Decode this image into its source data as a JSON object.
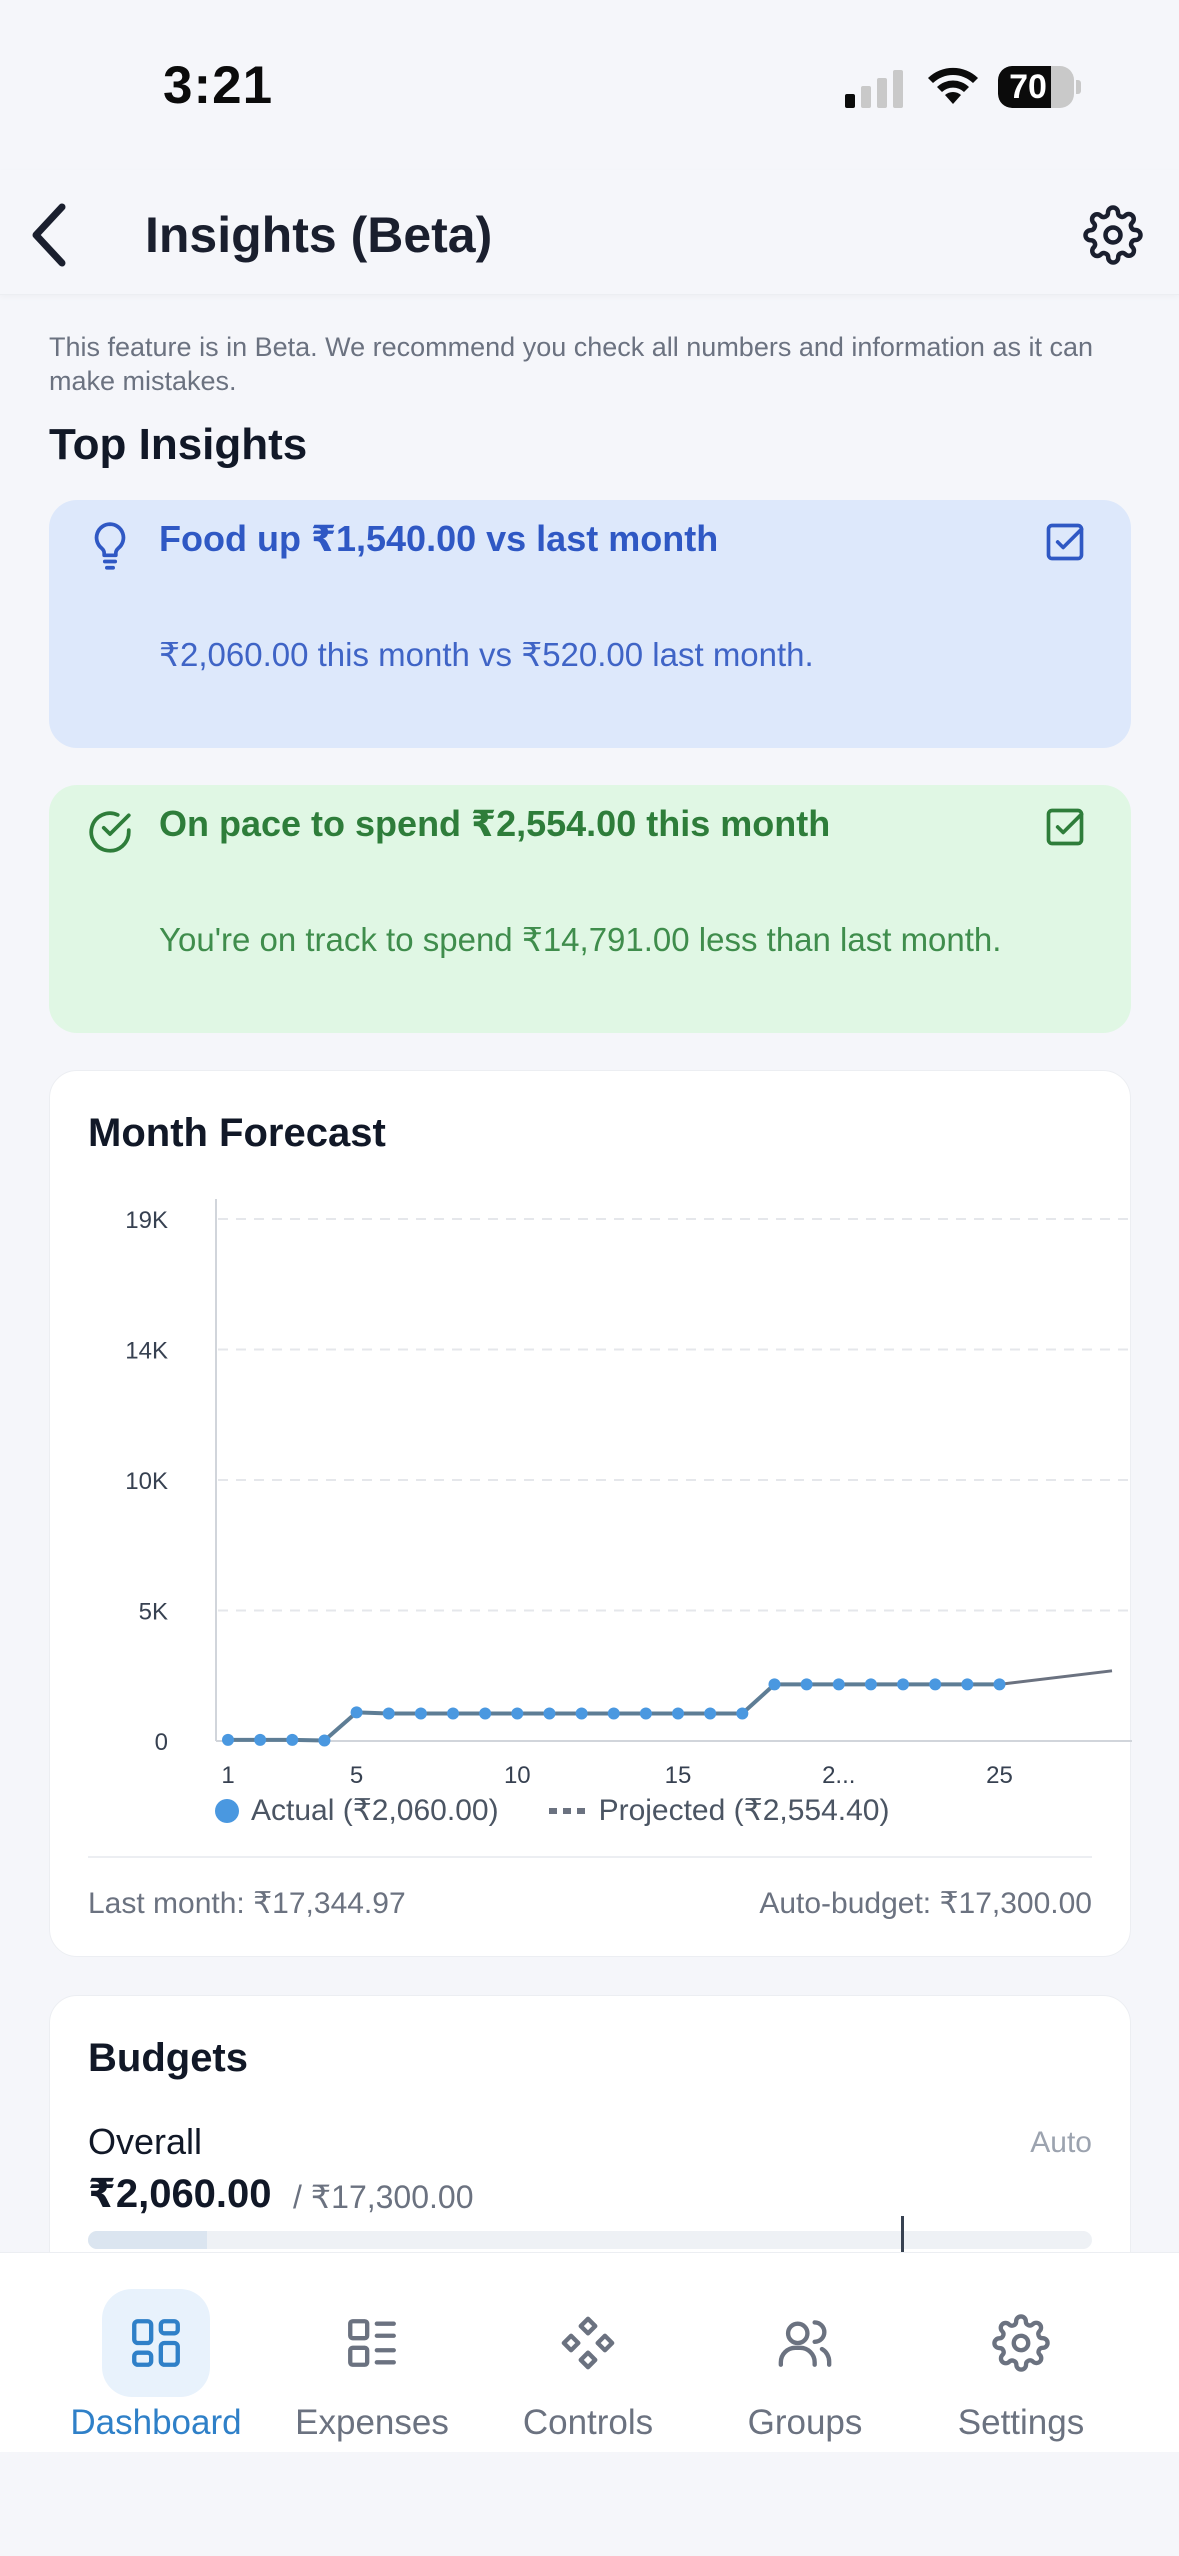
{
  "status_bar": {
    "time": "3:21",
    "battery_level": "70",
    "battery_fraction": 0.7
  },
  "header": {
    "title": "Insights (Beta)",
    "back_icon": "chevron-left-icon",
    "settings_icon": "gear-icon"
  },
  "beta_note": "This feature is in Beta. We recommend you check all numbers and information as it can make mistakes.",
  "top_insights": {
    "heading": "Top Insights",
    "cards": [
      {
        "icon": "lightbulb-icon",
        "title": "Food up ₹1,540.00 vs last month",
        "body": "₹2,060.00 this month vs ₹520.00 last month.",
        "color": "#2f58c4"
      },
      {
        "icon": "check-circle-icon",
        "title": "On pace to spend ₹2,554.00 this month",
        "body": "You're on track to spend ₹14,791.00 less than last month.",
        "color": "#2e7d3a"
      }
    ]
  },
  "forecast": {
    "title": "Month Forecast",
    "legend_actual": "Actual (₹2,060.00)",
    "legend_projected": "Projected (₹2,554.40)",
    "last_month": "Last month: ₹17,344.97",
    "auto_budget": "Auto-budget: ₹17,300.00"
  },
  "chart_data": {
    "type": "line",
    "title": "Month Forecast",
    "xlabel": "",
    "ylabel": "",
    "xlim": [
      1,
      28.5
    ],
    "ylim": [
      0,
      19000
    ],
    "x_ticks": [
      {
        "value": 1,
        "label": "1"
      },
      {
        "value": 5,
        "label": "5"
      },
      {
        "value": 10,
        "label": "10"
      },
      {
        "value": 15,
        "label": "15"
      },
      {
        "value": 20,
        "label": "2..."
      },
      {
        "value": 25,
        "label": "25"
      }
    ],
    "y_ticks": [
      {
        "value": 0,
        "label": "0"
      },
      {
        "value": 4750,
        "label": "5K"
      },
      {
        "value": 9500,
        "label": "10K"
      },
      {
        "value": 14250,
        "label": "14K"
      },
      {
        "value": 19000,
        "label": "19K"
      }
    ],
    "grid": true,
    "legend_position": "bottom",
    "series": [
      {
        "name": "Actual (₹2,060.00)",
        "color": "#4a98e0",
        "line_color": "#5e7d95",
        "x": [
          1,
          2,
          3,
          4,
          5,
          6,
          7,
          8,
          9,
          10,
          11,
          12,
          13,
          14,
          15,
          16,
          17,
          18,
          19,
          20,
          21,
          22,
          23,
          24,
          25
        ],
        "y": [
          40,
          40,
          40,
          20,
          1040,
          1000,
          1000,
          1000,
          1000,
          1000,
          1000,
          1000,
          1000,
          1000,
          1000,
          1000,
          1000,
          2060,
          2060,
          2060,
          2060,
          2060,
          2060,
          2060,
          2060
        ]
      },
      {
        "name": "Projected (₹2,554.40)",
        "color": "#6b7280",
        "x": [
          25,
          28.5
        ],
        "y": [
          2060,
          2554.4
        ]
      }
    ]
  },
  "budgets": {
    "title": "Budgets",
    "item_name": "Overall",
    "item_mode": "Auto",
    "spent": "₹2,060.00",
    "total": "/ ₹17,300.00",
    "spent_fraction": 0.119,
    "expected_fraction": 0.81
  },
  "nav": [
    {
      "label": "Dashboard",
      "icon": "dashboard-icon",
      "active": true
    },
    {
      "label": "Expenses",
      "icon": "list-icon",
      "active": false
    },
    {
      "label": "Controls",
      "icon": "controls-icon",
      "active": false
    },
    {
      "label": "Groups",
      "icon": "users-icon",
      "active": false
    },
    {
      "label": "Settings",
      "icon": "gear-icon",
      "active": false
    }
  ]
}
